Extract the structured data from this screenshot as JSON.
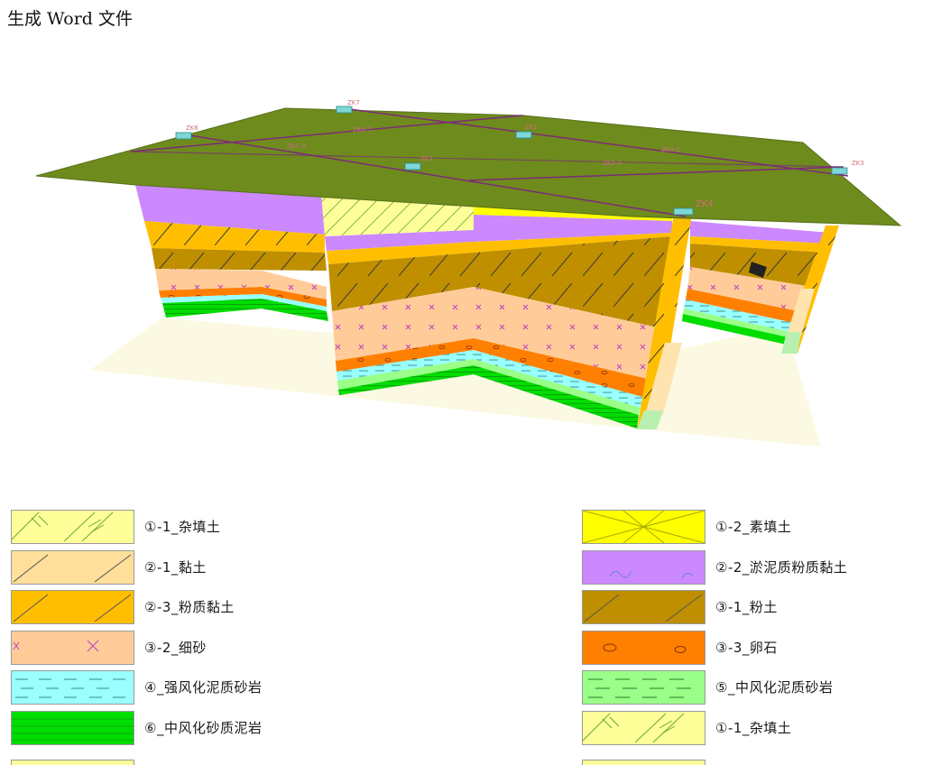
{
  "heading": "生成 Word 文件",
  "boreholes": [
    {
      "id": "zk1",
      "label": "ZK1"
    },
    {
      "id": "zk2",
      "label": "ZK2"
    },
    {
      "id": "zk3",
      "label": "ZK3"
    },
    {
      "id": "zk4",
      "label": "ZK4"
    },
    {
      "id": "zk6",
      "label": "ZK6"
    },
    {
      "id": "zk7",
      "label": "ZK7"
    }
  ],
  "section_lines": [
    {
      "id": "line-a",
      "label": "ZK1-3"
    },
    {
      "id": "line-b",
      "label": "ZK4-5"
    },
    {
      "id": "line-c",
      "label": "ZK6-7"
    },
    {
      "id": "line-d",
      "label": "ZK2-4"
    }
  ],
  "colors": {
    "surface": "#6e8b1d",
    "surface_line": "#7d2a7a",
    "borehole_cap": "#7fd6d6"
  },
  "legend": {
    "left": [
      {
        "label": "①-1_杂填土",
        "color": "#ffff99",
        "pattern": "hatch-cross"
      },
      {
        "label": "②-1_黏土",
        "color": "#ffdf99",
        "pattern": "diag"
      },
      {
        "label": "②-3_粉质黏土",
        "color": "#ffbf00",
        "pattern": "diag"
      },
      {
        "label": "③-2_细砂",
        "color": "#ffcc99",
        "pattern": "x"
      },
      {
        "label": "④_强风化泥质砂岩",
        "color": "#99ffff",
        "pattern": "dash-dot"
      },
      {
        "label": "⑥_中风化砂质泥岩",
        "color": "#00dd00",
        "pattern": "lines"
      }
    ],
    "right": [
      {
        "label": "①-2_素填土",
        "color": "#ffff00",
        "pattern": "big-x"
      },
      {
        "label": "②-2_淤泥质粉质黏土",
        "color": "#cc88ff",
        "pattern": "wave"
      },
      {
        "label": "③-1_粉土",
        "color": "#bf8f00",
        "pattern": "diag"
      },
      {
        "label": "③-3_卵石",
        "color": "#ff8000",
        "pattern": "ovals"
      },
      {
        "label": "⑤_中风化泥质砂岩",
        "color": "#99ff88",
        "pattern": "dash"
      },
      {
        "label": "①-1_杂填土",
        "color": "#ffff99",
        "pattern": "hatch-cross"
      }
    ]
  }
}
